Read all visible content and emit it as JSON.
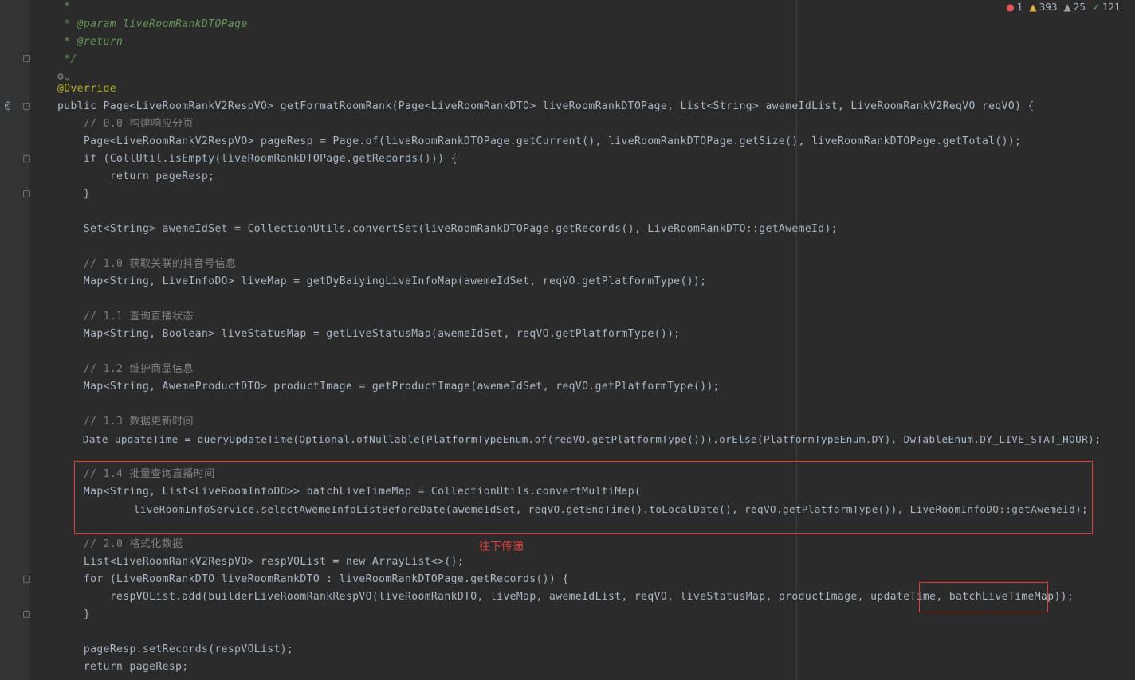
{
  "status": {
    "errors": "1",
    "warnings": "393",
    "weak_warnings": "25",
    "typos": "121"
  },
  "gutter_marks": [
    "@"
  ],
  "annotations": {
    "note_text": "往下传递"
  },
  "lines": [
    {
      "t": " *"
    },
    {
      "t": " * @param liveRoomRankDTOPage"
    },
    {
      "t": " * @return"
    },
    {
      "t": " */"
    },
    {
      "t": ""
    },
    {
      "t": "@Override"
    },
    {
      "t": "public Page<LiveRoomRankV2RespVO> getFormatRoomRank(Page<LiveRoomRankDTO> liveRoomRankDTOPage, List<String> awemeIdList, LiveRoomRankV2ReqVO reqVO) {"
    },
    {
      "t": "    // 0.0 构建响应分页"
    },
    {
      "t": "    Page<LiveRoomRankV2RespVO> pageResp = Page.of(liveRoomRankDTOPage.getCurrent(), liveRoomRankDTOPage.getSize(), liveRoomRankDTOPage.getTotal());"
    },
    {
      "t": "    if (CollUtil.isEmpty(liveRoomRankDTOPage.getRecords())) {"
    },
    {
      "t": "        return pageResp;"
    },
    {
      "t": "    }"
    },
    {
      "t": ""
    },
    {
      "t": "    Set<String> awemeIdSet = CollectionUtils.convertSet(liveRoomRankDTOPage.getRecords(), LiveRoomRankDTO::getAwemeId);"
    },
    {
      "t": ""
    },
    {
      "t": "    // 1.0 获取关联的抖音号信息"
    },
    {
      "t": "    Map<String, LiveInfoDO> liveMap = getDyBaiyingLiveInfoMap(awemeIdSet, reqVO.getPlatformType());"
    },
    {
      "t": ""
    },
    {
      "t": "    // 1.1 查询直播状态"
    },
    {
      "t": "    Map<String, Boolean> liveStatusMap = getLiveStatusMap(awemeIdSet, reqVO.getPlatformType());"
    },
    {
      "t": ""
    },
    {
      "t": "    // 1.2 维护商品信息"
    },
    {
      "t": "    Map<String, AwemeProductDTO> productImage = getProductImage(awemeIdSet, reqVO.getPlatformType());"
    },
    {
      "t": ""
    },
    {
      "t": "    // 1.3 数据更新时间"
    },
    {
      "t": "    Date updateTime = queryUpdateTime(Optional.ofNullable(PlatformTypeEnum.of(reqVO.getPlatformType())).orElse(PlatformTypeEnum.DY), DwTableEnum.DY_LIVE_STAT_HOUR);"
    },
    {
      "t": ""
    },
    {
      "t": "    // 1.4 批量查询直播时间"
    },
    {
      "t": "    Map<String, List<LiveRoomInfoDO>> batchLiveTimeMap = CollectionUtils.convertMultiMap("
    },
    {
      "t": "            liveRoomInfoService.selectAwemeInfoListBeforeDate(awemeIdSet, reqVO.getEndTime().toLocalDate(), reqVO.getPlatformType()), LiveRoomInfoDO::getAwemeId);"
    },
    {
      "t": ""
    },
    {
      "t": "    // 2.0 格式化数据"
    },
    {
      "t": "    List<LiveRoomRankV2RespVO> respVOList = new ArrayList<>();"
    },
    {
      "t": "    for (LiveRoomRankDTO liveRoomRankDTO : liveRoomRankDTOPage.getRecords()) {"
    },
    {
      "t": "        respVOList.add(builderLiveRoomRankRespVO(liveRoomRankDTO, liveMap, awemeIdList, reqVO, liveStatusMap, productImage, updateTime, batchLiveTimeMap));"
    },
    {
      "t": "    }"
    },
    {
      "t": ""
    },
    {
      "t": "    pageResp.setRecords(respVOList);"
    },
    {
      "t": "    return pageResp;"
    }
  ]
}
